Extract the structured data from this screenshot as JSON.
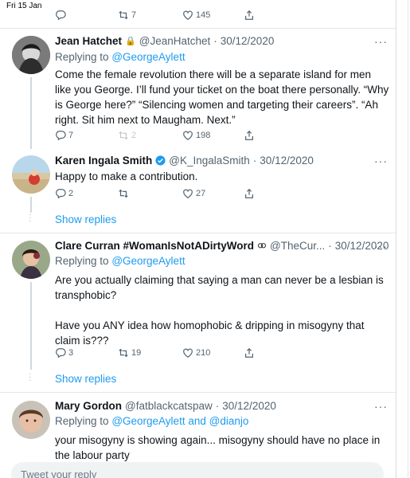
{
  "statusbar": {
    "date": "Fri 15 Jan"
  },
  "top_actions": {
    "retweets": "7",
    "likes": "145"
  },
  "tweets": [
    {
      "name": "Jean Hatchet",
      "lock": "🔒",
      "handle": "@JeanHatchet",
      "sep": "·",
      "date": "30/12/2020",
      "replying_prefix": "Replying to",
      "replying_to": "@GeorgeAylett",
      "text": "Come the female revolution there will be a separate island for men like you George. I’ll fund your ticket on the boat there personally. “Why is George here?” “Silencing women and targeting their careers”. “Ah right. Sit him next to Maugham. Next.”",
      "replies": "7",
      "retweets": "2",
      "likes": "198"
    },
    {
      "name": "Karen Ingala Smith",
      "handle": "@K_IngalaSmith",
      "sep": "·",
      "date": "30/12/2020",
      "text": "Happy to make a contribution.",
      "replies": "2",
      "retweets": "",
      "likes": "27"
    },
    {
      "name": "Clare Curran #WomanIsNotADirtyWord",
      "handle": "@TheCur...",
      "sep": "·",
      "date": "30/12/2020",
      "replying_prefix": "Replying to",
      "replying_to": "@GeorgeAylett",
      "text": "Are you actually claiming that saying a man can never be a lesbian is transphobic?\n\nHave you ANY idea how homophobic & dripping in misogyny that claim is???",
      "replies": "3",
      "retweets": "19",
      "likes": "210"
    },
    {
      "name": "Mary Gordon",
      "handle": "@fatblackcatspaw",
      "sep": "·",
      "date": "30/12/2020",
      "replying_prefix": "Replying to",
      "replying_to": "@GeorgeAylett",
      "replying_and": "and",
      "replying_to_2": "@dianjo",
      "text": "your misogyny is showing again... misogyny should have no place in the labour party"
    }
  ],
  "show_replies": "Show replies",
  "more": "···",
  "compose_placeholder": "Tweet your reply"
}
